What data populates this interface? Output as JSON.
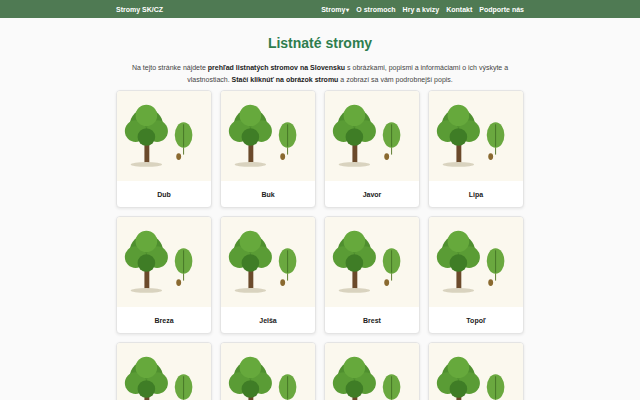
{
  "nav": {
    "brand": "Stromy SK/CZ",
    "items": [
      {
        "label": "Stromy",
        "caret": "▾"
      },
      {
        "label": "O stromoch",
        "caret": null
      },
      {
        "label": "Hry a kvízy",
        "caret": null
      },
      {
        "label": "Kontakt",
        "caret": null
      },
      {
        "label": "Podporte nás",
        "caret": null
      }
    ]
  },
  "page": {
    "title": "Listnaté stromy",
    "intro": [
      {
        "text": "Na tejto stránke nájdete ",
        "bold": false
      },
      {
        "text": "prehľad listnatých stromov na Slovensku",
        "bold": true
      },
      {
        "text": " s obrázkami, popismi a informáciami o ich výskyte a vlastnostiach. ",
        "bold": false
      },
      {
        "text": "Stačí kliknúť na obrázok stromu",
        "bold": true
      },
      {
        "text": " a zobrazí sa vám podrobnejší popis.",
        "bold": false
      }
    ]
  },
  "trees": [
    {
      "name": "Dub"
    },
    {
      "name": "Buk"
    },
    {
      "name": "Javor"
    },
    {
      "name": "Lipa"
    },
    {
      "name": "Breza"
    },
    {
      "name": "Jelša"
    },
    {
      "name": "Brest"
    },
    {
      "name": "Topoľ"
    },
    {
      "name": null
    },
    {
      "name": null
    },
    {
      "name": null
    },
    {
      "name": null
    }
  ]
}
